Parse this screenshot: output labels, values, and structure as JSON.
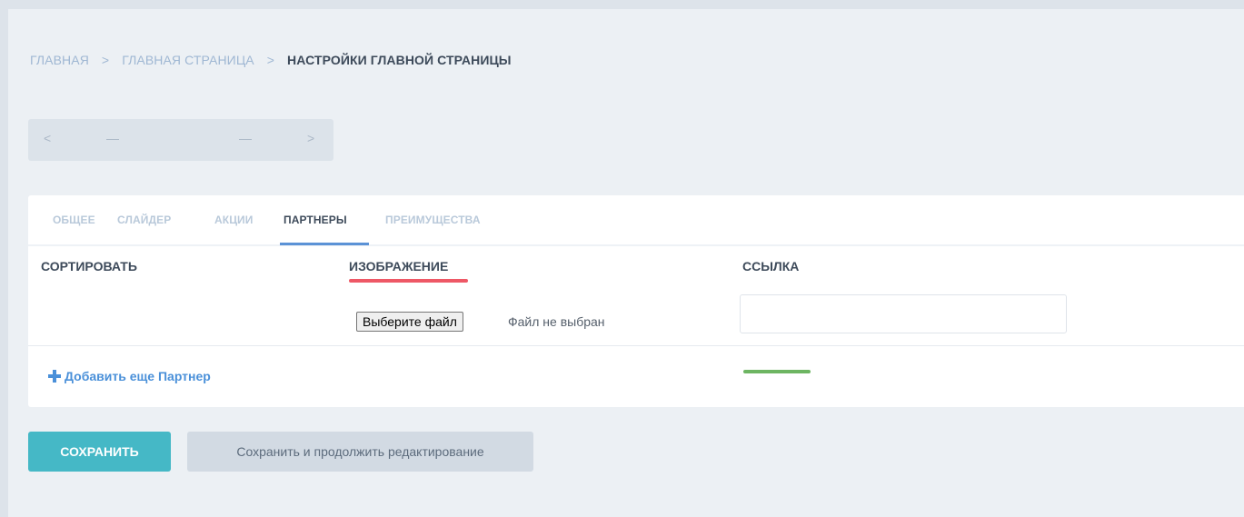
{
  "breadcrumb": {
    "items": [
      "ГЛАВНАЯ",
      "ГЛАВНАЯ СТРАНИЦА",
      "НАСТРОЙКИ ГЛАВНОЙ СТРАНИЦЫ"
    ],
    "separator": ">"
  },
  "pager": {
    "prev": "<",
    "left_value": "—",
    "right_value": "—",
    "next": ">"
  },
  "tabs": [
    {
      "label": "ОБЩЕЕ",
      "active": false
    },
    {
      "label": "СЛАЙДЕР",
      "active": false
    },
    {
      "label": "АКЦИИ",
      "active": false
    },
    {
      "label": "ПАРТНЕРЫ",
      "active": true
    },
    {
      "label": "ПРЕИМУЩЕСТВА",
      "active": false
    }
  ],
  "table": {
    "columns": [
      "СОРТИРОВАТЬ",
      "ИЗОБРАЖЕНИЕ",
      "ССЫЛКА"
    ],
    "row": {
      "file_button": "Выберите файл",
      "file_status": "Файл не выбран",
      "link_value": ""
    }
  },
  "add_link": "Добавить еще Партнер",
  "actions": {
    "save": "СОХРАНИТЬ",
    "save_continue": "Сохранить и продолжить редактирование"
  },
  "colors": {
    "accent": "#45b8c6",
    "link": "#4a90d9",
    "highlight_red": "#ee5866",
    "highlight_green": "#6db562"
  },
  "icons": {
    "add": "plus-icon",
    "prev": "chevron-left-icon",
    "next": "chevron-right-icon"
  }
}
